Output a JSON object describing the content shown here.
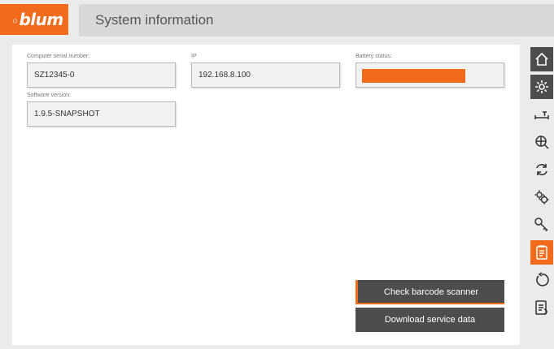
{
  "header": {
    "logo_text": "blum",
    "title": "System information"
  },
  "fields": {
    "serial": {
      "label": "Computer serial number:",
      "value": "SZ12345-0"
    },
    "ip": {
      "label": "IP",
      "value": "192.168.8.100"
    },
    "battery": {
      "label": "Battery status:",
      "level_percent": 100,
      "color": "#f26b1d"
    },
    "software": {
      "label": "Software version:",
      "value": "1.9.5-SNAPSHOT"
    }
  },
  "buttons": {
    "check_scanner": "Check barcode scanner",
    "download_service": "Download service data"
  },
  "sidebar": {
    "items": [
      {
        "icon": "home-icon",
        "state": "dark"
      },
      {
        "icon": "settings-gear-icon",
        "state": "dark"
      },
      {
        "icon": "measure-icon",
        "state": "normal"
      },
      {
        "icon": "zoom-globe-icon",
        "state": "normal"
      },
      {
        "icon": "sync-icon",
        "state": "normal"
      },
      {
        "icon": "gears-icon",
        "state": "normal"
      },
      {
        "icon": "key-icon",
        "state": "normal"
      },
      {
        "icon": "clipboard-icon",
        "state": "active"
      },
      {
        "icon": "restart-icon",
        "state": "normal"
      },
      {
        "icon": "document-icon",
        "state": "normal"
      }
    ]
  },
  "colors": {
    "accent": "#f26b1d",
    "dark": "#4d4d4d"
  }
}
